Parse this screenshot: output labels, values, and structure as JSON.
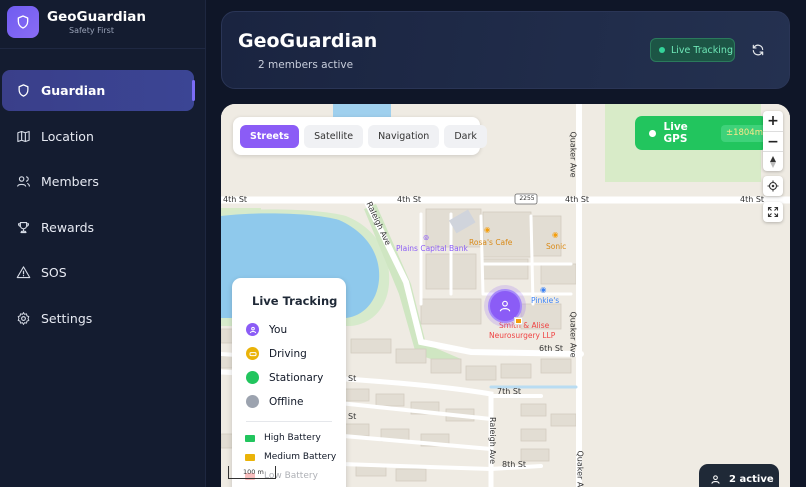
{
  "brand": {
    "title": "GeoGuardian",
    "subtitle": "Safety First"
  },
  "nav": [
    {
      "label": "Guardian",
      "icon": "shield-icon",
      "active": true
    },
    {
      "label": "Location",
      "icon": "map-icon"
    },
    {
      "label": "Members",
      "icon": "users-icon"
    },
    {
      "label": "Rewards",
      "icon": "trophy-icon"
    },
    {
      "label": "SOS",
      "icon": "warning-icon"
    },
    {
      "label": "Settings",
      "icon": "gear-icon"
    }
  ],
  "header": {
    "title": "GeoGuardian",
    "subtitle": "2 members active",
    "live_label": "Live Tracking",
    "refresh_icon": "refresh-icon"
  },
  "map": {
    "styles": [
      "Streets",
      "Satellite",
      "Navigation",
      "Dark"
    ],
    "active_style": "Streets",
    "gps": {
      "label": "Live GPS",
      "accuracy": "±1804m"
    },
    "zoom": {
      "in": "+",
      "out": "−"
    },
    "streets": {
      "fourth_left": "4th St",
      "fourth_mid": "4th St",
      "fourth_r1": "4th St",
      "fourth_r2": "4th St",
      "sixth": "6th St",
      "seventh": "7th St",
      "eighth": "8th St",
      "raleigh": "Raleigh Ave",
      "raleigh2": "Raleigh Ave",
      "quaker": "Quaker Ave",
      "quaker2": "Quaker Ave",
      "quaker3": "Quaker Ave",
      "route": "2255",
      "st_frag1": "St",
      "st_frag2": "St"
    },
    "pois": {
      "bank": "Plains Capital Bank",
      "cafe": "Rosa's Cafe",
      "sonic": "Sonic",
      "pinkies": "Pinkie's",
      "neuro1": "Smith & Alise",
      "neuro2": "Neurosurgery LLP"
    },
    "legend": {
      "title": "Live Tracking",
      "items": [
        "You",
        "Driving",
        "Stationary",
        "Offline"
      ],
      "battery": [
        "High Battery",
        "Medium Battery",
        "Low Battery"
      ]
    },
    "scale": "100 m",
    "active_count": "2 active"
  },
  "colors": {
    "accent": "#8b5cf6",
    "live_green": "#22c55e",
    "driving": "#eab308",
    "offline": "#9ca3af"
  }
}
